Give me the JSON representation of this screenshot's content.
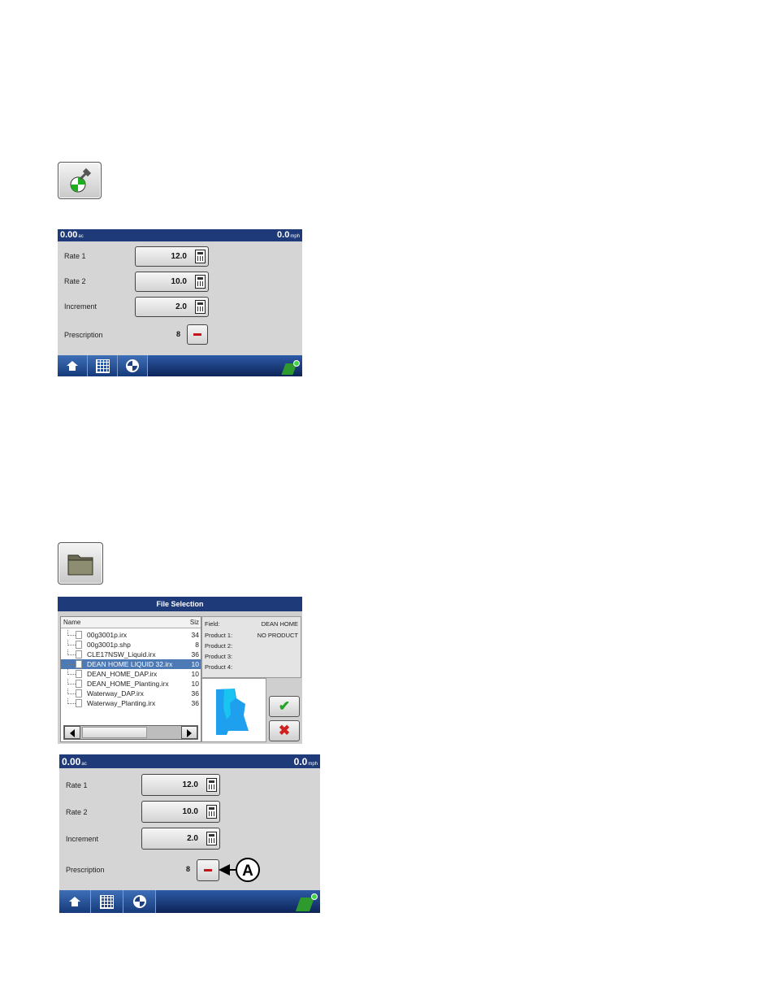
{
  "icons": {
    "diagnostics_button": "wrench-pie-icon",
    "folder_button": "folder-icon"
  },
  "console1": {
    "area_value": "0.00",
    "area_unit": "ac",
    "speed_value": "0.0",
    "speed_unit": "mph",
    "rate1_label": "Rate 1",
    "rate1_value": "12.0",
    "rate2_label": "Rate 2",
    "rate2_value": "10.0",
    "increment_label": "Increment",
    "increment_value": "2.0",
    "prescription_label": "Prescription",
    "prescription_value": "8"
  },
  "file_selection": {
    "title": "File Selection",
    "col_name": "Name",
    "col_size": "Siz",
    "files": [
      {
        "name": "00g3001p.irx",
        "size": "34"
      },
      {
        "name": "00g3001p.shp",
        "size": "8"
      },
      {
        "name": "CLE17NSW_Liquid.irx",
        "size": "36"
      },
      {
        "name": "DEAN HOME LIQUID 32.irx",
        "size": "10",
        "selected": true
      },
      {
        "name": "DEAN_HOME_DAP.irx",
        "size": "10"
      },
      {
        "name": "DEAN_HOME_Planting.irx",
        "size": "10"
      },
      {
        "name": "Waterway_DAP.irx",
        "size": "36"
      },
      {
        "name": "Waterway_Planting.irx",
        "size": "36"
      }
    ],
    "info": {
      "field_label": "Field:",
      "field_value": "DEAN HOME",
      "product1_label": "Product 1:",
      "product1_value": "NO PRODUCT",
      "product2_label": "Product 2:",
      "product3_label": "Product 3:",
      "product4_label": "Product 4:"
    },
    "colors": {
      "preview_fill": "#1fa0ee",
      "preview_fill_light": "#19c4f0"
    }
  },
  "console2": {
    "area_value": "0.00",
    "area_unit": "ac",
    "speed_value": "0.0",
    "speed_unit": "mph",
    "rate1_label": "Rate 1",
    "rate1_value": "12.0",
    "rate2_label": "Rate 2",
    "rate2_value": "10.0",
    "increment_label": "Increment",
    "increment_value": "2.0",
    "prescription_label": "Prescription",
    "prescription_value": "8",
    "callout_label": "A"
  },
  "colors": {
    "header": "#1e3a78",
    "panel": "#d5d5d5",
    "accent_red": "#c4161c",
    "gps_green": "#2e9a2e"
  }
}
